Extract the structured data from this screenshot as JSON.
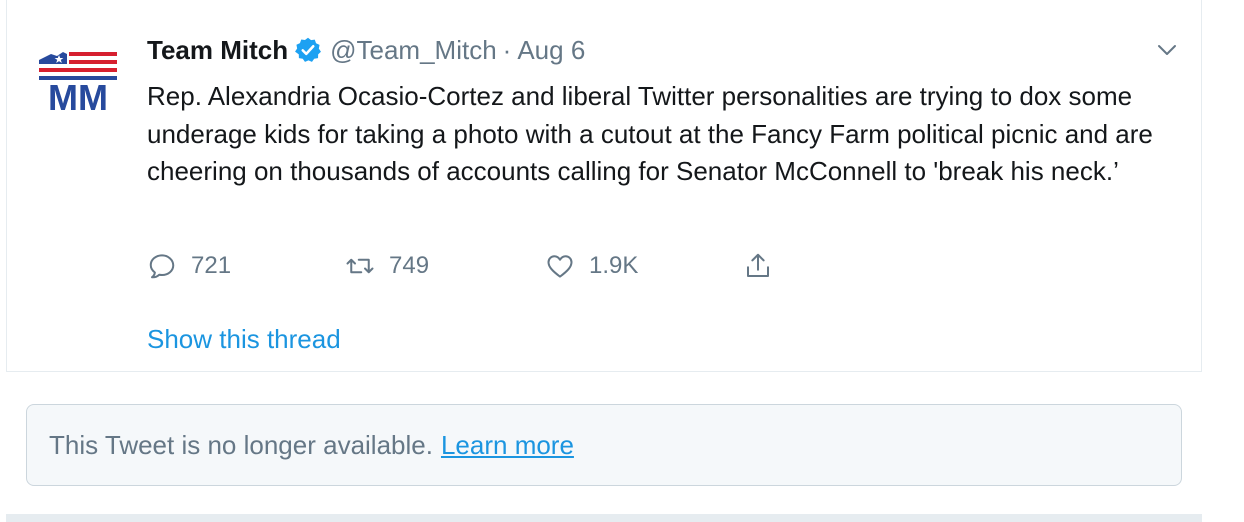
{
  "tweet": {
    "author_name": "Team Mitch",
    "handle": "@Team_Mitch",
    "separator": "·",
    "date": "Aug 6",
    "avatar_text": "MM",
    "text": "Rep. Alexandria Ocasio-Cortez and liberal Twitter personalities are trying to dox some underage kids for taking a photo with a cutout at the Fancy Farm political picnic and are cheering on thousands of accounts calling for Senator McConnell to 'break his neck.’",
    "replies": "721",
    "retweets": "749",
    "likes": "1.9K",
    "show_thread": "Show this thread"
  },
  "quoted": {
    "unavailable_text": "This Tweet is no longer available.",
    "learn_more": "Learn more"
  },
  "icons": {
    "verified": "verified-badge-icon",
    "caret": "chevron-down-icon",
    "reply": "reply-icon",
    "retweet": "retweet-icon",
    "like": "heart-icon",
    "share": "share-icon"
  },
  "colors": {
    "link": "#1b95e0",
    "muted": "#657786",
    "text": "#14171a",
    "avatar_red": "#d6202f",
    "avatar_blue": "#274a9d"
  }
}
